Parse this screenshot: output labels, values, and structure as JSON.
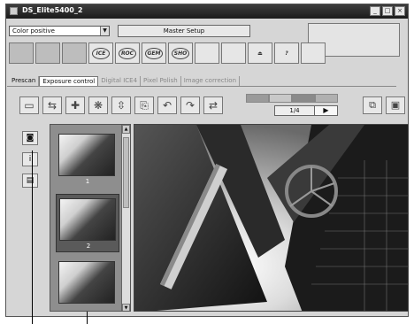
{
  "window": {
    "title": "DS_Elite5400_2",
    "buttons": [
      "_",
      "□",
      "×"
    ]
  },
  "film_type_select": {
    "value": "Color positive"
  },
  "master_setup_label": "Master Setup",
  "toolbar_icons": [
    {
      "name": "thumbnail-view-icon",
      "label": ""
    },
    {
      "name": "prescan-icon",
      "label": ""
    },
    {
      "name": "scan-icon",
      "label": ""
    },
    {
      "name": "ice-icon",
      "label": "ICE"
    },
    {
      "name": "roc-icon",
      "label": "ROC"
    },
    {
      "name": "gem-icon",
      "label": "GEM"
    },
    {
      "name": "sho-icon",
      "label": "SHO"
    },
    {
      "name": "grid-icon",
      "label": ""
    },
    {
      "name": "stack-icon",
      "label": ""
    },
    {
      "name": "eject-icon",
      "label": "⏏"
    },
    {
      "name": "help-icon",
      "label": "?"
    },
    {
      "name": "preferences-icon",
      "label": ""
    }
  ],
  "tabs": [
    {
      "label": "Prescan",
      "state": "normal"
    },
    {
      "label": "Exposure control",
      "state": "selected"
    },
    {
      "label": "Digital ICE4",
      "state": "dim"
    },
    {
      "label": "Pixel Polish",
      "state": "dim"
    },
    {
      "label": "Image correction",
      "state": "dim"
    }
  ],
  "preview_tools": [
    "crop-icon",
    "fit-icon",
    "focus-icon",
    "eyedropper-icon",
    "levels-icon",
    "copy-icon",
    "rotate-left-icon",
    "rotate-right-icon",
    "flip-icon"
  ],
  "page_indicator": "1/4",
  "play_label": "▶",
  "progress_colors": [
    "#9a9a9a",
    "#c8c8c8",
    "#8a8a8a",
    "#b0b0b0"
  ],
  "thumbnails": [
    {
      "label": "1",
      "selected": false
    },
    {
      "label": "2",
      "selected": true
    },
    {
      "label": "",
      "selected": false
    }
  ]
}
